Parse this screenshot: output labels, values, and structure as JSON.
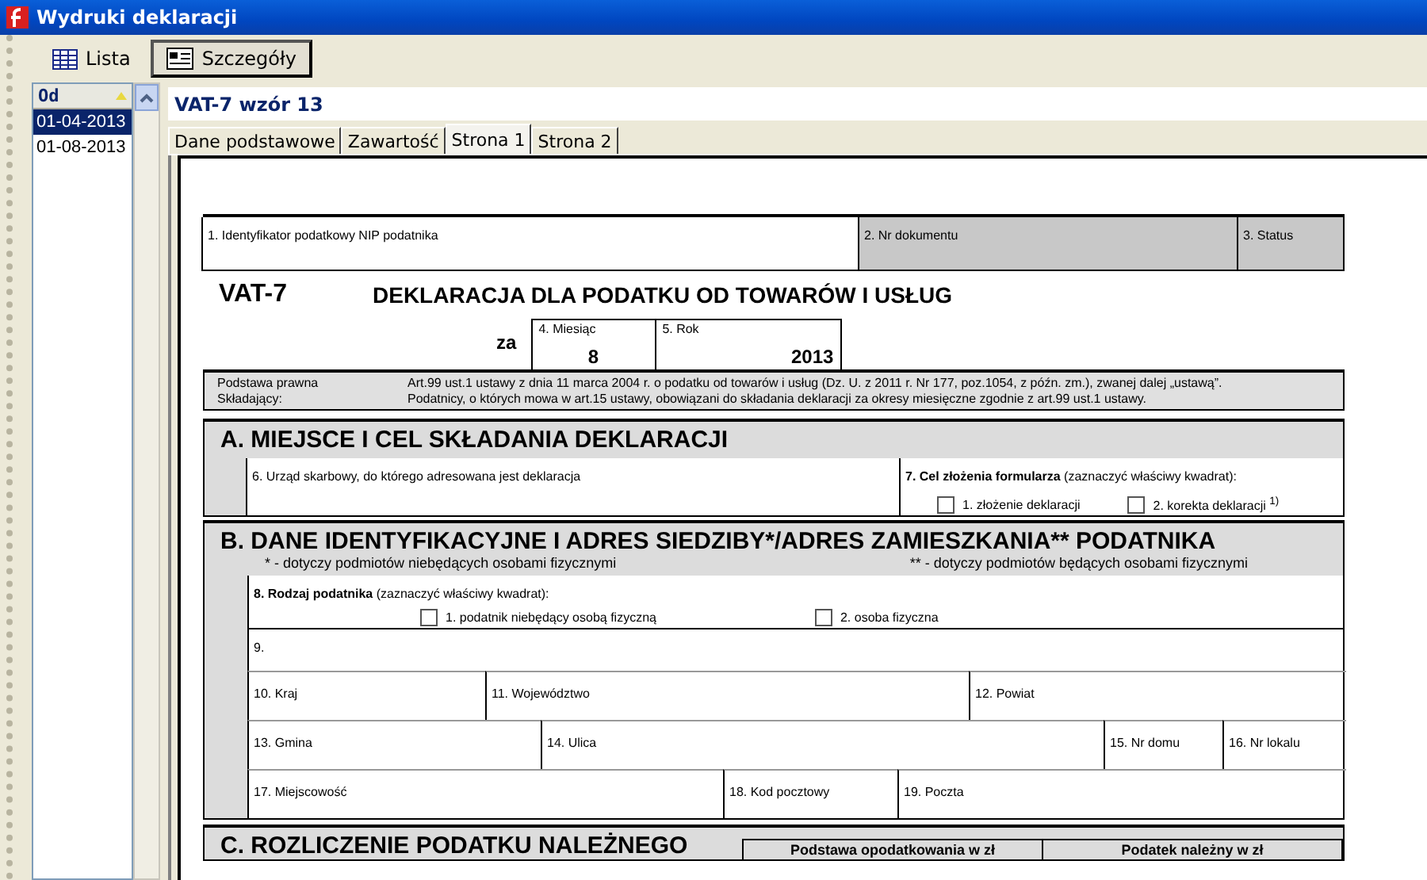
{
  "window": {
    "title": "Wydruki deklaracji"
  },
  "view_tabs": [
    {
      "label": "Lista",
      "kind": "list",
      "selected": false
    },
    {
      "label": "Szczegóły",
      "kind": "details",
      "selected": true
    }
  ],
  "list": {
    "column": "Od",
    "rows": [
      {
        "date": "01-04-2013",
        "selected": true
      },
      {
        "date": "01-08-2013",
        "selected": false
      }
    ]
  },
  "detail": {
    "title": "VAT-7 wzór 13",
    "tabs": [
      {
        "label": "Dane podstawowe",
        "selected": false
      },
      {
        "label": "Zawartość",
        "selected": false
      },
      {
        "label": "Strona 1",
        "selected": true
      },
      {
        "label": "Strona 2",
        "selected": false
      }
    ],
    "form": {
      "header_cells": [
        {
          "label": "1. Identyfikator podatkowy NIP podatnika",
          "shaded": false
        },
        {
          "label": "2. Nr dokumentu",
          "shaded": true
        },
        {
          "label": "3. Status",
          "shaded": true
        }
      ],
      "code": "VAT-7",
      "title": "DEKLARACJA DLA PODATKU OD TOWARÓW I USŁUG",
      "period": {
        "prefix": "za",
        "month_label": "4. Miesiąc",
        "month": "8",
        "year_label": "5. Rok",
        "year": "2013"
      },
      "legal": [
        {
          "label": "Podstawa prawna",
          "text": "Art.99 ust.1 ustawy z dnia 11 marca 2004 r. o podatku od towarów i usług (Dz. U. z 2011 r. Nr 177, poz.1054, z późn. zm.), zwanej dalej „ustawą”."
        },
        {
          "label": "Składający:",
          "text": "Podatnicy, o których mowa w art.15 ustawy, obowiązani do składania deklaracji za okresy miesięczne zgodnie z art.99 ust.1 ustawy."
        }
      ],
      "section_a": {
        "title": "A. MIEJSCE I CEL SKŁADANIA DEKLARACJI",
        "office_label": "6. Urząd skarbowy, do którego adresowana jest deklaracja",
        "purpose_label": "**7. Cel złożenia formularza** (zaznaczyć właściwy kwadrat):",
        "options": [
          {
            "label": "1. złożenie deklaracji",
            "checked": false
          },
          {
            "label": "2. korekta deklaracji $^{1)}$",
            "checked": false
          }
        ]
      },
      "section_b": {
        "title": "B. DANE IDENTYFIKACYJNE I ADRES SIEDZIBY*/ADRES ZAMIESZKANIA** PODATNIKA",
        "notes": [
          "* - dotyczy podmiotów niebędących osobami fizycznymi",
          "** - dotyczy podmiotów będących osobami fizycznymi"
        ],
        "type_label": "**8. Rodzaj podatnika** (zaznaczyć właściwy kwadrat):",
        "type_options": [
          {
            "label": "1. podatnik niebędący osobą fizyczną",
            "checked": false
          },
          {
            "label": "2. osoba fizyczna",
            "checked": false
          }
        ],
        "name_label": "9.",
        "address_rows": [
          [
            "10. Kraj",
            "11. Województwo",
            "12. Powiat"
          ],
          [
            "13. Gmina",
            "14. Ulica",
            "15. Nr domu",
            "16. Nr lokalu"
          ],
          [
            "17. Miejscowość",
            "18. Kod pocztowy",
            "19. Poczta"
          ]
        ]
      },
      "section_c": {
        "title": "C. ROZLICZENIE PODATKU NALEŻNEGO",
        "columns": [
          "Podstawa opodatkowania w zł",
          "Podatek należny w zł"
        ]
      }
    }
  }
}
